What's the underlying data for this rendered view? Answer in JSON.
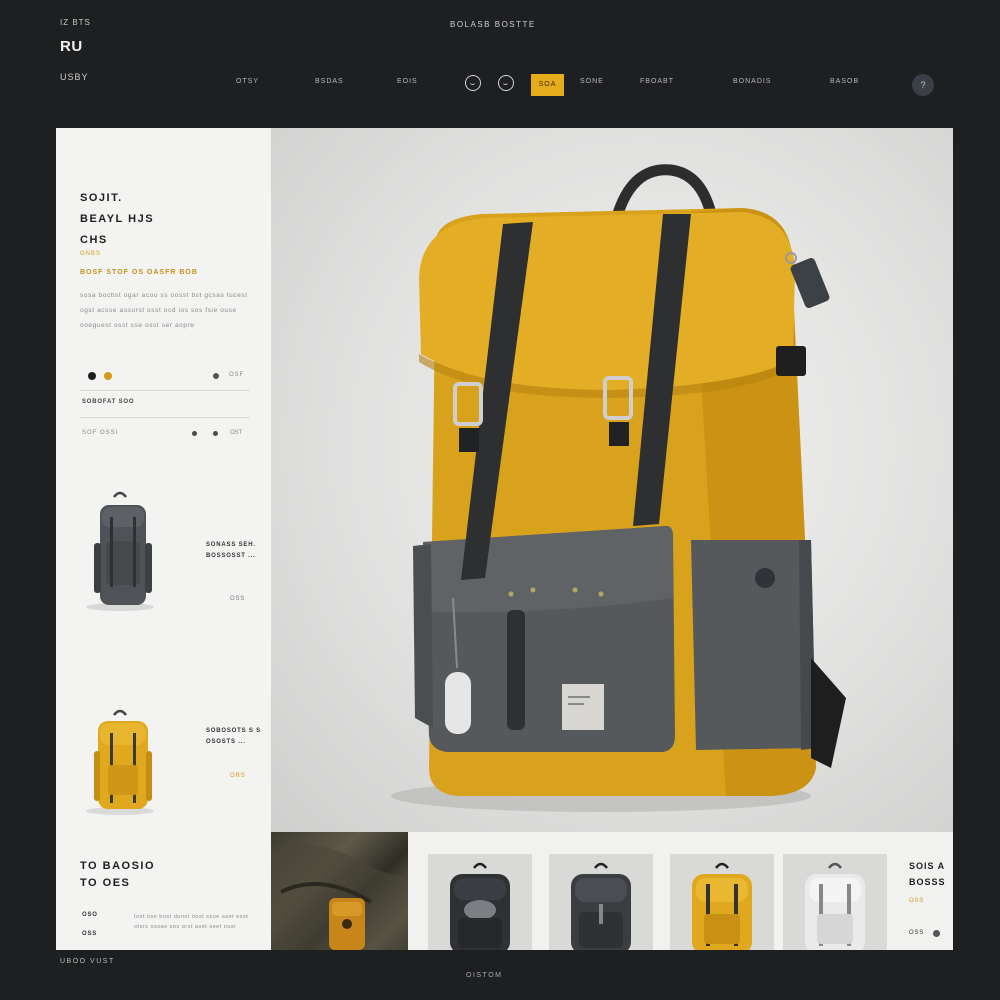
{
  "header": {
    "top_label": "IZ BTS",
    "logo": "RU",
    "sub_label": "USBY",
    "title": "BOLASB BOSTTE"
  },
  "nav": {
    "items": [
      "OTSY",
      "BSDAS",
      "EOIS",
      "SONE",
      "FBOABT",
      "BONADIS",
      "BASOB"
    ],
    "active_label": "SOA",
    "avatar_label": "?",
    "icons": [
      "globe-icon",
      "smile-icon"
    ]
  },
  "product": {
    "title": "SOJIT.\nBEAYL HJS\nCHS",
    "accent_small": "ONBS",
    "subheading": "BOSF STOF OS OASFR BOB",
    "description": "sosa bocbst ogar acou ss oosst bst gcsas tucest ogst acsse assurst osst ocd ios sos fsie ouse ooeguest osst sse osst ser aopre",
    "colors": [
      "#1d1d1d",
      "#d89a17",
      "#555555"
    ],
    "size_label": "OSF",
    "option_label": "SOBOFAT SOO",
    "qty_label": "SOF OSSI",
    "qty_value": "OST"
  },
  "thumbnails": [
    {
      "name": "SONASS SEH.\nBOSSOSST ...",
      "price": "OSS",
      "color": "gray"
    },
    {
      "name": "SOBOSOTS S S\nOSOSTS ...",
      "price": "ORS",
      "color": "yellow"
    }
  ],
  "promo": {
    "title": "TO BAOSIO\nTO OES",
    "link1": "OSO",
    "link2": "OSS",
    "description": "tost ose bost dunst oost ssue aset esst otsrs ossae sos orst aset seet ousr"
  },
  "strip": {
    "title": "SOIS A\nBOSSS",
    "accent": "OSS",
    "more_label": "OSS"
  },
  "footer": {
    "left": "UBOO VUST",
    "center": "OISTOM"
  },
  "colors": {
    "accent": "#e5ad1c",
    "background": "#1e1f21",
    "backpack_yellow": "#d9a21c",
    "backpack_gray": "#55595c"
  }
}
